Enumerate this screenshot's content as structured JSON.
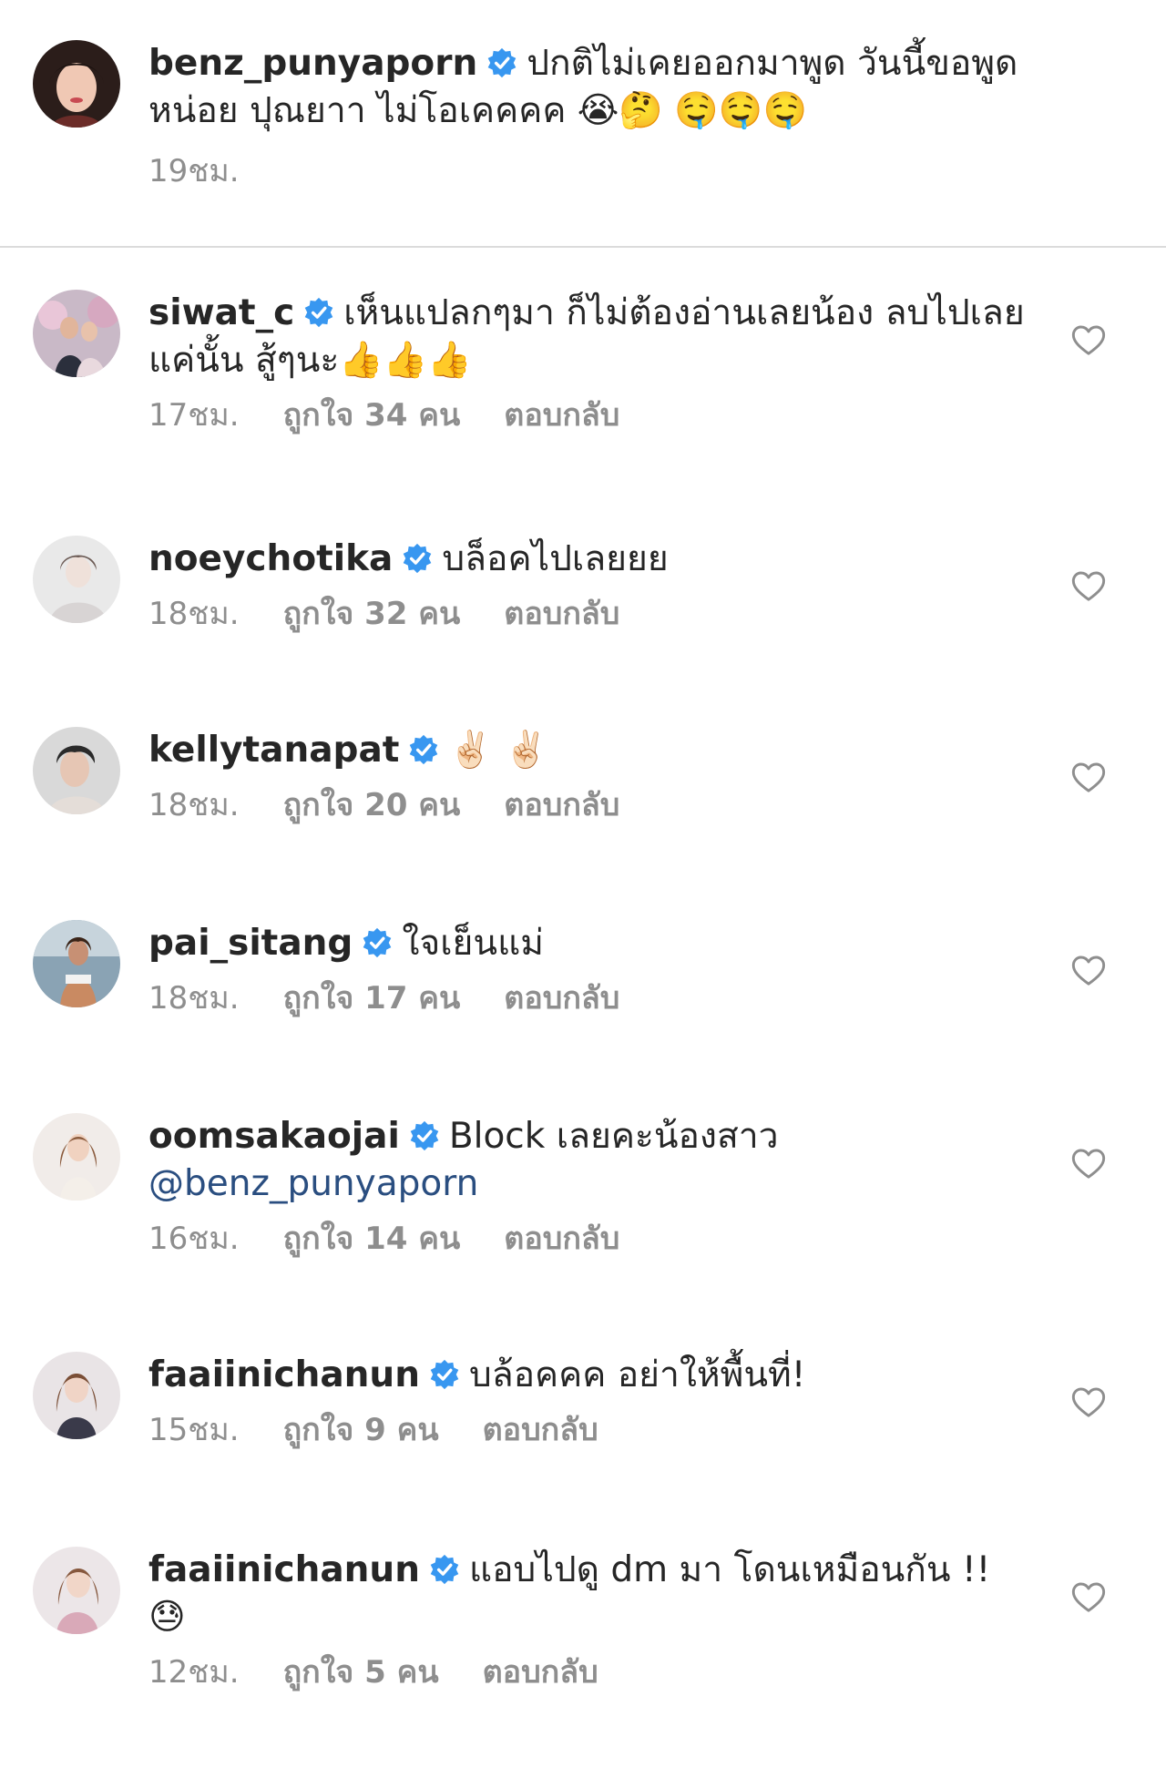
{
  "colors": {
    "text": "#262626",
    "meta": "#8e8e8e",
    "verified_badge": "#3897f0",
    "mention": "#2a4e80",
    "divider": "#dbdbdb"
  },
  "caption": {
    "username": "benz_punyaporn",
    "verified": true,
    "text": "ปกติไม่เคยออกมาพูด วันนี้ขอพูดหน่อย ปุณยาา ไม่โอเคคคค 😭🤔 🤤🤤🤤",
    "time": "19ชม."
  },
  "comments": [
    {
      "username": "siwat_c",
      "verified": true,
      "text": "เห็นแปลกๆมา ก็ไม่ต้องอ่านเลยน้อง ลบไปเลยแค่นั้น สู้ๆนะ👍👍👍",
      "time": "17ชม.",
      "likes": "ถูกใจ 34 คน",
      "reply": "ตอบกลับ",
      "heart_icon": "heart-outline"
    },
    {
      "username": "noeychotika",
      "verified": true,
      "text": "บล็อคไปเลยยย",
      "time": "18ชม.",
      "likes": "ถูกใจ 32 คน",
      "reply": "ตอบกลับ",
      "heart_icon": "heart-outline"
    },
    {
      "username": "kellytanapat",
      "verified": true,
      "text": "✌🏻 ✌🏻",
      "time": "18ชม.",
      "likes": "ถูกใจ 20 คน",
      "reply": "ตอบกลับ",
      "heart_icon": "heart-outline"
    },
    {
      "username": "pai_sitang",
      "verified": true,
      "text": "ใจเย็นแม่",
      "time": "18ชม.",
      "likes": "ถูกใจ 17 คน",
      "reply": "ตอบกลับ",
      "heart_icon": "heart-outline"
    },
    {
      "username": "oomsakaojai",
      "verified": true,
      "text": "Block เลยคะน้องสาว",
      "mention": "@benz_punyaporn",
      "time": "16ชม.",
      "likes": "ถูกใจ 14 คน",
      "reply": "ตอบกลับ",
      "heart_icon": "heart-outline"
    },
    {
      "username": "faaiinichanun",
      "verified": true,
      "text": "บล้อคคค อย่าให้พื้นที่!",
      "time": "15ชม.",
      "likes": "ถูกใจ 9 คน",
      "reply": "ตอบกลับ",
      "heart_icon": "heart-outline"
    },
    {
      "username": "faaiinichanun",
      "verified": true,
      "text": "แอบไปดู dm มา โดนเหมือนกัน !! 😓",
      "time": "12ชม.",
      "likes": "ถูกใจ 5 คน",
      "reply": "ตอบกลับ",
      "heart_icon": "heart-outline"
    }
  ]
}
